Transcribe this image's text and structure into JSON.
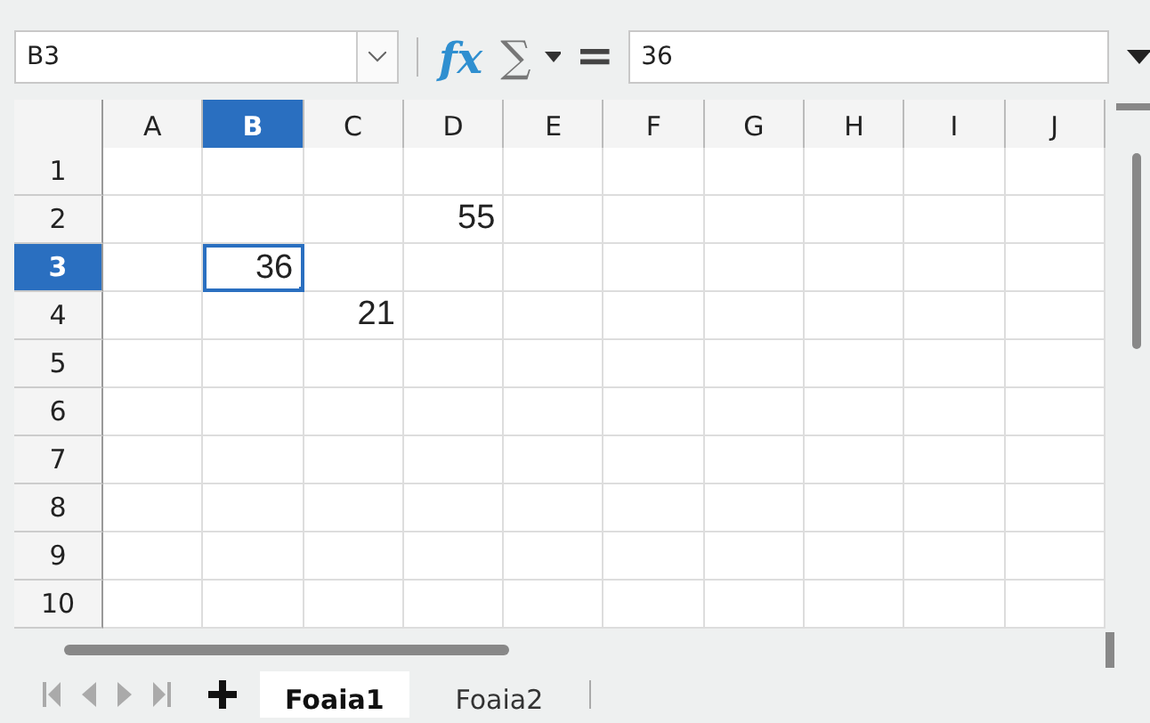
{
  "name_box": {
    "value": "B3"
  },
  "formula_bar": {
    "buttons": [
      {
        "kind": "wizard",
        "label": "fx"
      },
      {
        "kind": "sum",
        "label": "∑"
      },
      {
        "kind": "equals",
        "label": "="
      }
    ],
    "value": "36"
  },
  "columns": [
    {
      "label": "A",
      "selected": false
    },
    {
      "label": "B",
      "selected": true
    },
    {
      "label": "C",
      "selected": false
    },
    {
      "label": "D",
      "selected": false
    },
    {
      "label": "E",
      "selected": false
    },
    {
      "label": "F",
      "selected": false
    },
    {
      "label": "G",
      "selected": false
    },
    {
      "label": "H",
      "selected": false
    },
    {
      "label": "I",
      "selected": false
    },
    {
      "label": "J",
      "selected": false
    }
  ],
  "rows": [
    {
      "label": "1",
      "selected": false,
      "cells": [
        {
          "selected": false
        },
        {
          "selected": false
        },
        {
          "selected": false
        },
        {
          "selected": false
        },
        {
          "selected": false
        },
        {
          "selected": false
        },
        {
          "selected": false
        },
        {
          "selected": false
        },
        {
          "selected": false
        },
        {
          "selected": false
        }
      ]
    },
    {
      "label": "2",
      "selected": false,
      "cells": [
        {
          "selected": false
        },
        {
          "selected": false
        },
        {
          "selected": false
        },
        {
          "value": "55",
          "selected": false
        },
        {
          "selected": false
        },
        {
          "selected": false
        },
        {
          "selected": false
        },
        {
          "selected": false
        },
        {
          "selected": false
        },
        {
          "selected": false
        }
      ]
    },
    {
      "label": "3",
      "selected": true,
      "cells": [
        {
          "selected": false
        },
        {
          "value": "36",
          "selected": true
        },
        {
          "selected": false
        },
        {
          "selected": false
        },
        {
          "selected": false
        },
        {
          "selected": false
        },
        {
          "selected": false
        },
        {
          "selected": false
        },
        {
          "selected": false
        },
        {
          "selected": false
        }
      ]
    },
    {
      "label": "4",
      "selected": false,
      "cells": [
        {
          "selected": false
        },
        {
          "selected": false
        },
        {
          "value": "21",
          "selected": false
        },
        {
          "selected": false
        },
        {
          "selected": false
        },
        {
          "selected": false
        },
        {
          "selected": false
        },
        {
          "selected": false
        },
        {
          "selected": false
        },
        {
          "selected": false
        }
      ]
    },
    {
      "label": "5",
      "selected": false,
      "cells": [
        {
          "selected": false
        },
        {
          "selected": false
        },
        {
          "selected": false
        },
        {
          "selected": false
        },
        {
          "selected": false
        },
        {
          "selected": false
        },
        {
          "selected": false
        },
        {
          "selected": false
        },
        {
          "selected": false
        },
        {
          "selected": false
        }
      ]
    },
    {
      "label": "6",
      "selected": false,
      "cells": [
        {
          "selected": false
        },
        {
          "selected": false
        },
        {
          "selected": false
        },
        {
          "selected": false
        },
        {
          "selected": false
        },
        {
          "selected": false
        },
        {
          "selected": false
        },
        {
          "selected": false
        },
        {
          "selected": false
        },
        {
          "selected": false
        }
      ]
    },
    {
      "label": "7",
      "selected": false,
      "cells": [
        {
          "selected": false
        },
        {
          "selected": false
        },
        {
          "selected": false
        },
        {
          "selected": false
        },
        {
          "selected": false
        },
        {
          "selected": false
        },
        {
          "selected": false
        },
        {
          "selected": false
        },
        {
          "selected": false
        },
        {
          "selected": false
        }
      ]
    },
    {
      "label": "8",
      "selected": false,
      "cells": [
        {
          "selected": false
        },
        {
          "selected": false
        },
        {
          "selected": false
        },
        {
          "selected": false
        },
        {
          "selected": false
        },
        {
          "selected": false
        },
        {
          "selected": false
        },
        {
          "selected": false
        },
        {
          "selected": false
        },
        {
          "selected": false
        }
      ]
    },
    {
      "label": "9",
      "selected": false,
      "cells": [
        {
          "selected": false
        },
        {
          "selected": false
        },
        {
          "selected": false
        },
        {
          "selected": false
        },
        {
          "selected": false
        },
        {
          "selected": false
        },
        {
          "selected": false
        },
        {
          "selected": false
        },
        {
          "selected": false
        },
        {
          "selected": false
        }
      ]
    },
    {
      "label": "10",
      "selected": false,
      "cells": [
        {
          "selected": false
        },
        {
          "selected": false
        },
        {
          "selected": false
        },
        {
          "selected": false
        },
        {
          "selected": false
        },
        {
          "selected": false
        },
        {
          "selected": false
        },
        {
          "selected": false
        },
        {
          "selected": false
        },
        {
          "selected": false
        }
      ]
    }
  ],
  "sheet_tabs": [
    {
      "label": "Foaia1",
      "selected": true
    },
    {
      "label": "Foaia2",
      "selected": false
    }
  ]
}
